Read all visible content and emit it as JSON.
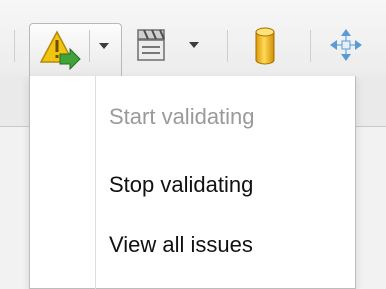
{
  "toolbar": {
    "buttons": [
      {
        "icon": "warning-triangle-arrow-icon",
        "has_dropdown": true,
        "active": true
      },
      {
        "icon": "film-clapper-icon",
        "has_dropdown": true
      },
      {
        "icon": "database-cylinder-icon",
        "has_dropdown": false
      },
      {
        "icon": "move-arrows-icon",
        "has_dropdown": false
      }
    ]
  },
  "menu": {
    "items": [
      {
        "label": "Start validating",
        "enabled": false
      },
      {
        "label": "Stop validating",
        "enabled": true
      },
      {
        "label": "View all issues",
        "enabled": true
      }
    ]
  },
  "colors": {
    "warning_yellow": "#f1c40f",
    "arrow_green": "#3fa23a",
    "database_gold": "#f1b40e",
    "move_blue": "#5b9bd5",
    "disabled_text": "#9a9a9a"
  }
}
